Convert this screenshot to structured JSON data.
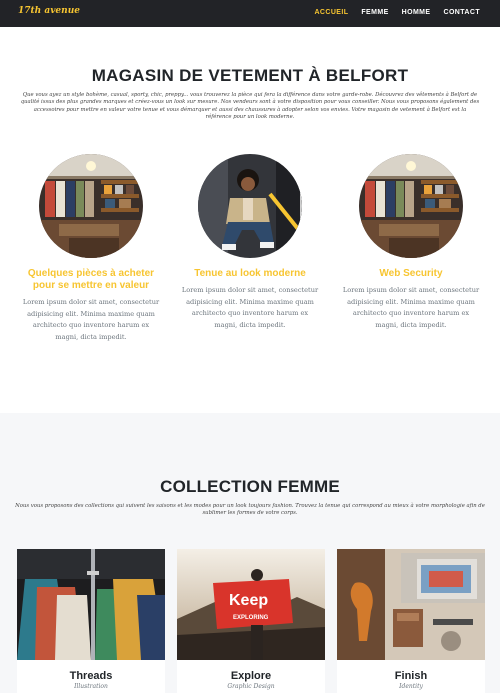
{
  "navbar": {
    "brand": "17th avenue",
    "links": [
      {
        "label": "ACCUEIL",
        "active": true
      },
      {
        "label": "FEMME",
        "active": false
      },
      {
        "label": "HOMME",
        "active": false
      },
      {
        "label": "CONTACT",
        "active": false
      }
    ]
  },
  "store": {
    "title": "MAGASIN DE VETEMENT À BELFORT",
    "intro": "Que vous ayez un style bohème, casual, sporty, chic, preppy... vous trouverez la pièce qui fera la différence dans votre garde-robe. Découvrez des vêtements à Belfort de qualité issus des plus grandes marques et créez-vous un look sur mesure. Nos vendeurs sont à votre disposition pour vous conseiller. Nous vous proposons également des accessoires pour mettre en valeur votre tenue et vous démarquer et aussi des chaussures à adopter selon vos envies. Votre magasin de vetement à Belfort est la référence pour un look moderne.",
    "features": [
      {
        "title": "Quelques pièces à acheter pour se mettre en valeur",
        "text": "Lorem ipsum dolor sit amet, consectetur adipisicing elit. Minima maxime quam architecto quo inventore harum ex magni, dicta impedit.",
        "image": "boutique-interior"
      },
      {
        "title": "Tenue au look moderne",
        "text": "Lorem ipsum dolor sit amet, consectetur adipisicing elit. Minima maxime quam architecto quo inventore harum ex magni, dicta impedit.",
        "image": "man-modern-outfit"
      },
      {
        "title": "Web Security",
        "text": "Lorem ipsum dolor sit amet, consectetur adipisicing elit. Minima maxime quam architecto quo inventore harum ex magni, dicta impedit.",
        "image": "boutique-interior"
      }
    ]
  },
  "collection": {
    "title": "COLLECTION FEMME",
    "intro": "Nous vous proposons des collections qui suivent les saisons et les modes pour un look toujours fashion. Trouvez la tenue qui correspond au mieux à votre morphologie afin de sublimer les formes de votre corps.",
    "cards": [
      {
        "title": "Threads",
        "subtitle": "Illustration",
        "image": "shirts-on-hangers"
      },
      {
        "title": "Explore",
        "subtitle": "Graphic Design",
        "image": "keep-exploring-flag"
      },
      {
        "title": "Finish",
        "subtitle": "Identity",
        "image": "desk-objects"
      }
    ]
  },
  "colors": {
    "accent": "#f7c531",
    "navbar_bg": "#222327",
    "section_bg": "#f6f7f9"
  }
}
